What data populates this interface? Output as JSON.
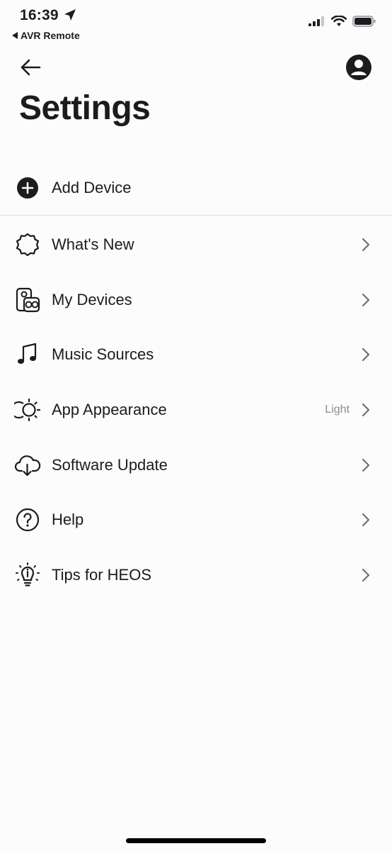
{
  "status_bar": {
    "time": "16:39",
    "back_app": "AVR Remote"
  },
  "header": {
    "title": "Settings"
  },
  "add_device": {
    "label": "Add Device"
  },
  "menu": [
    {
      "label": "What's New",
      "icon": "badge-icon"
    },
    {
      "label": "My Devices",
      "icon": "speaker-icon"
    },
    {
      "label": "Music Sources",
      "icon": "music-note-icon"
    },
    {
      "label": "App Appearance",
      "icon": "appearance-icon",
      "value": "Light"
    },
    {
      "label": "Software Update",
      "icon": "cloud-download-icon"
    },
    {
      "label": "Help",
      "icon": "help-icon"
    },
    {
      "label": "Tips for HEOS",
      "icon": "lightbulb-icon"
    }
  ],
  "colors": {
    "background": "#fcfcfd",
    "text": "#1c1c1f",
    "secondary_text": "#8b8d94",
    "chevron": "#6e7078",
    "divider": "#dcdce0"
  }
}
